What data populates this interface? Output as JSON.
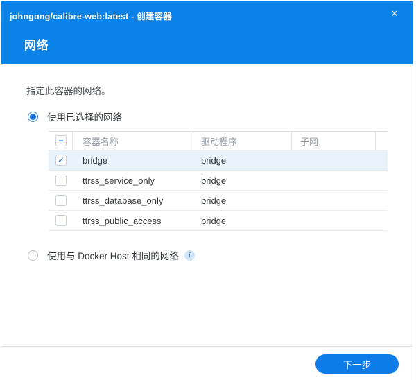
{
  "window": {
    "title": "johngong/calibre-web:latest - 创建容器",
    "close_glyph": "✕"
  },
  "header": {
    "title": "网络"
  },
  "main": {
    "description": "指定此容器的网络。",
    "radio_selected_networks": {
      "label": "使用已选择的网络",
      "selected": true
    },
    "radio_docker_host": {
      "label": "使用与 Docker Host 相同的网络",
      "selected": false,
      "info_glyph": "i"
    },
    "table": {
      "columns": [
        "容器名称",
        "驱动程序",
        "子网"
      ],
      "select_all_state": "indeterminate",
      "rows": [
        {
          "checked": true,
          "selected": true,
          "name": "bridge",
          "driver": "bridge",
          "subnet": ""
        },
        {
          "checked": false,
          "selected": false,
          "name": "ttrss_service_only",
          "driver": "bridge",
          "subnet": ""
        },
        {
          "checked": false,
          "selected": false,
          "name": "ttrss_database_only",
          "driver": "bridge",
          "subnet": ""
        },
        {
          "checked": false,
          "selected": false,
          "name": "ttrss_public_access",
          "driver": "bridge",
          "subnet": ""
        }
      ]
    }
  },
  "footer": {
    "next_label": "下一步"
  },
  "icons": {
    "check_glyph": "✓",
    "minus_glyph": "−"
  },
  "colors": {
    "accent_blue": "#0a82e8",
    "button_blue": "#0d7ce8",
    "selected_row_bg": "#e9f3fc",
    "check_blue": "#1778f2"
  }
}
